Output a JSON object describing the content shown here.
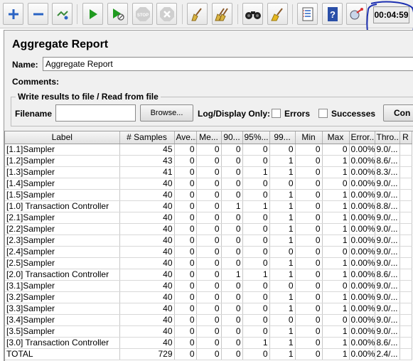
{
  "toolbar": {
    "buttons": [
      {
        "name": "add-icon"
      },
      {
        "name": "remove-icon"
      },
      {
        "name": "toggle-icon"
      },
      {
        "name": "start-icon"
      },
      {
        "name": "start-no-timers-icon"
      },
      {
        "name": "stop-icon",
        "label": "STOP"
      },
      {
        "name": "shutdown-icon"
      },
      {
        "name": "clear-icon"
      },
      {
        "name": "clear-all-icon"
      },
      {
        "name": "search-icon"
      },
      {
        "name": "reset-search-icon"
      },
      {
        "name": "function-helper-icon"
      },
      {
        "name": "help-icon"
      },
      {
        "name": "remote-icon"
      }
    ],
    "timer": "00:04:59"
  },
  "panel": {
    "title": "Aggregate Report",
    "name_label": "Name:",
    "name_value": "Aggregate Report",
    "comments_label": "Comments:",
    "file_group_label": "Write results to file / Read from file",
    "filename_label": "Filename",
    "filename_value": "",
    "browse_label": "Browse...",
    "log_display_label": "Log/Display Only:",
    "errors_label": "Errors",
    "successes_label": "Successes",
    "configure_label": "Con"
  },
  "table": {
    "columns": [
      "Label",
      "# Samples",
      "Ave...",
      "Me...",
      "90...",
      "95%...",
      "99...",
      "Min",
      "Max",
      "Error...",
      "Thro...",
      "R"
    ],
    "rows": [
      [
        "[1.1]Sampler",
        "45",
        "0",
        "0",
        "0",
        "0",
        "0",
        "0",
        "0",
        "0.00%",
        "9.0/...",
        ""
      ],
      [
        "[1.2]Sampler",
        "43",
        "0",
        "0",
        "0",
        "0",
        "1",
        "0",
        "1",
        "0.00%",
        "8.6/...",
        ""
      ],
      [
        "[1.3]Sampler",
        "41",
        "0",
        "0",
        "0",
        "1",
        "1",
        "0",
        "1",
        "0.00%",
        "8.3/...",
        ""
      ],
      [
        "[1.4]Sampler",
        "40",
        "0",
        "0",
        "0",
        "0",
        "0",
        "0",
        "0",
        "0.00%",
        "9.0/...",
        ""
      ],
      [
        "[1.5]Sampler",
        "40",
        "0",
        "0",
        "0",
        "0",
        "1",
        "0",
        "1",
        "0.00%",
        "9.0/...",
        ""
      ],
      [
        "[1.0] Transaction Controller",
        "40",
        "0",
        "0",
        "1",
        "1",
        "1",
        "0",
        "1",
        "0.00%",
        "8.8/...",
        ""
      ],
      [
        "[2.1]Sampler",
        "40",
        "0",
        "0",
        "0",
        "0",
        "1",
        "0",
        "1",
        "0.00%",
        "9.0/...",
        ""
      ],
      [
        "[2.2]Sampler",
        "40",
        "0",
        "0",
        "0",
        "0",
        "1",
        "0",
        "1",
        "0.00%",
        "9.0/...",
        ""
      ],
      [
        "[2.3]Sampler",
        "40",
        "0",
        "0",
        "0",
        "0",
        "1",
        "0",
        "1",
        "0.00%",
        "9.0/...",
        ""
      ],
      [
        "[2.4]Sampler",
        "40",
        "0",
        "0",
        "0",
        "0",
        "0",
        "0",
        "0",
        "0.00%",
        "9.0/...",
        ""
      ],
      [
        "[2.5]Sampler",
        "40",
        "0",
        "0",
        "0",
        "0",
        "1",
        "0",
        "1",
        "0.00%",
        "9.0/...",
        ""
      ],
      [
        "[2.0] Transaction Controller",
        "40",
        "0",
        "0",
        "1",
        "1",
        "1",
        "0",
        "1",
        "0.00%",
        "8.6/...",
        ""
      ],
      [
        "[3.1]Sampler",
        "40",
        "0",
        "0",
        "0",
        "0",
        "0",
        "0",
        "0",
        "0.00%",
        "9.0/...",
        ""
      ],
      [
        "[3.2]Sampler",
        "40",
        "0",
        "0",
        "0",
        "0",
        "1",
        "0",
        "1",
        "0.00%",
        "9.0/...",
        ""
      ],
      [
        "[3.3]Sampler",
        "40",
        "0",
        "0",
        "0",
        "0",
        "1",
        "0",
        "1",
        "0.00%",
        "9.0/...",
        ""
      ],
      [
        "[3.4]Sampler",
        "40",
        "0",
        "0",
        "0",
        "0",
        "0",
        "0",
        "0",
        "0.00%",
        "9.0/...",
        ""
      ],
      [
        "[3.5]Sampler",
        "40",
        "0",
        "0",
        "0",
        "0",
        "1",
        "0",
        "1",
        "0.00%",
        "9.0/...",
        ""
      ],
      [
        "[3.0] Transaction Controller",
        "40",
        "0",
        "0",
        "0",
        "1",
        "1",
        "0",
        "1",
        "0.00%",
        "8.6/...",
        ""
      ],
      [
        "TOTAL",
        "729",
        "0",
        "0",
        "0",
        "0",
        "1",
        "0",
        "1",
        "0.00%",
        "2.4/...",
        ""
      ]
    ]
  }
}
